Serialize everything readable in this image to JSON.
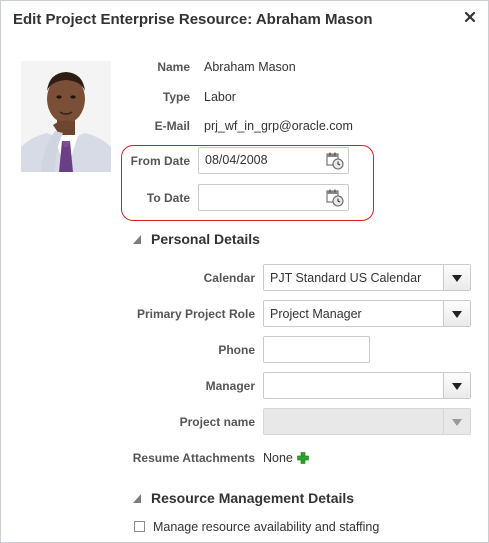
{
  "dialog": {
    "title": "Edit Project Enterprise Resource: Abraham Mason",
    "close_icon": "close-icon"
  },
  "resource": {
    "name_label": "Name",
    "name_value": "Abraham Mason",
    "type_label": "Type",
    "type_value": "Labor",
    "email_label": "E-Mail",
    "email_value": "prj_wf_in_grp@oracle.com",
    "from_date_label": "From Date",
    "from_date_value": "08/04/2008",
    "to_date_label": "To Date",
    "to_date_value": "",
    "calendar_icon": "calendar-icon"
  },
  "personal_details": {
    "heading": "Personal Details",
    "calendar_label": "Calendar",
    "calendar_value": "PJT Standard US Calendar",
    "role_label": "Primary Project Role",
    "role_value": "Project Manager",
    "phone_label": "Phone",
    "phone_value": "",
    "manager_label": "Manager",
    "manager_value": "",
    "project_label": "Project name",
    "project_value": "",
    "attachments_label": "Resume Attachments",
    "attachments_value": "None"
  },
  "resource_management": {
    "heading": "Resource Management Details",
    "checkbox_label": "Manage resource availability and staffing",
    "checkbox_checked": false
  },
  "colors": {
    "highlight": "#d71f2a",
    "add_icon": "#2aa52a"
  }
}
